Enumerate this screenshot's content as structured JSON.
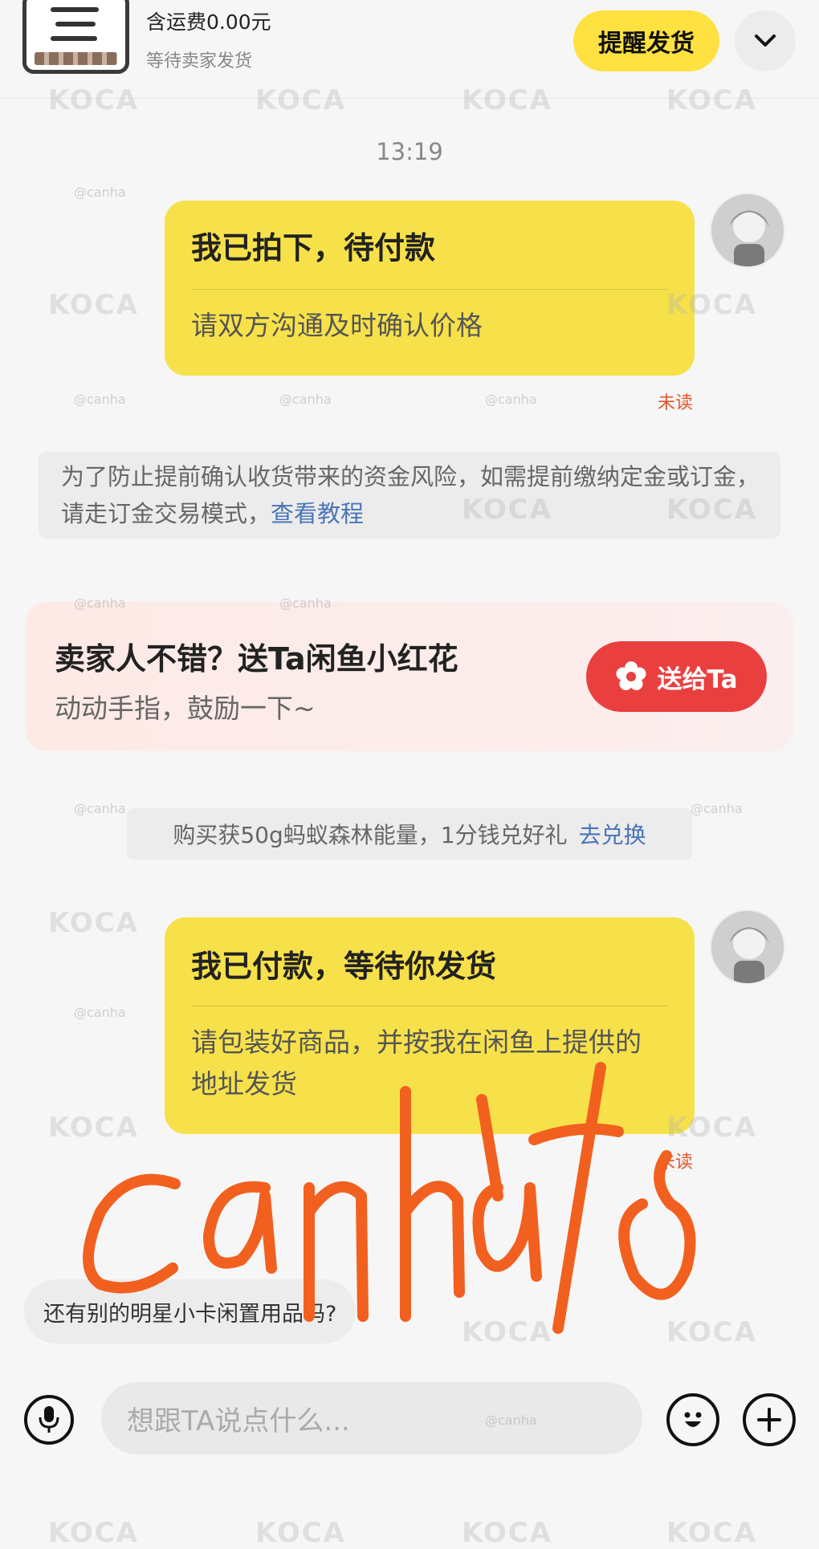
{
  "order": {
    "shipping_fee": "含运费0.00元",
    "status": "等待卖家发货",
    "remind_button": "提醒发货"
  },
  "chat": {
    "timestamp": "13:19",
    "message1": {
      "title": "我已拍下，待付款",
      "body": "请双方沟通及时确认价格",
      "status": "未读"
    },
    "notice": {
      "text": "为了防止提前确认收货带来的资金风险，如需提前缴纳定金或订金，请走订金交易模式，",
      "link": "查看教程"
    },
    "flower": {
      "title": "卖家人不错？送Ta闲鱼小红花",
      "subtitle": "动动手指，鼓励一下~",
      "button": "送给Ta"
    },
    "energy": {
      "text": "购买获50g蚂蚁森林能量，1分钱兑好礼",
      "link": "去兑换"
    },
    "message2": {
      "title": "我已付款，等待你发货",
      "body": "请包装好商品，并按我在闲鱼上提供的地址发货",
      "status": "未读"
    },
    "incoming_message": "还有别的明星小卡闲置用品吗?"
  },
  "composer": {
    "placeholder": "想跟TA说点什么..."
  },
  "watermark": {
    "logo": "KOCA",
    "handle": "@canha"
  },
  "signature_text": "Canha 4/18",
  "colors": {
    "yellow_card": "#f7e14a",
    "remind_button": "#ffe141",
    "gift_button": "#e9403f",
    "link": "#4a74b8",
    "unread": "#e0582c",
    "signature": "#f2601f"
  }
}
